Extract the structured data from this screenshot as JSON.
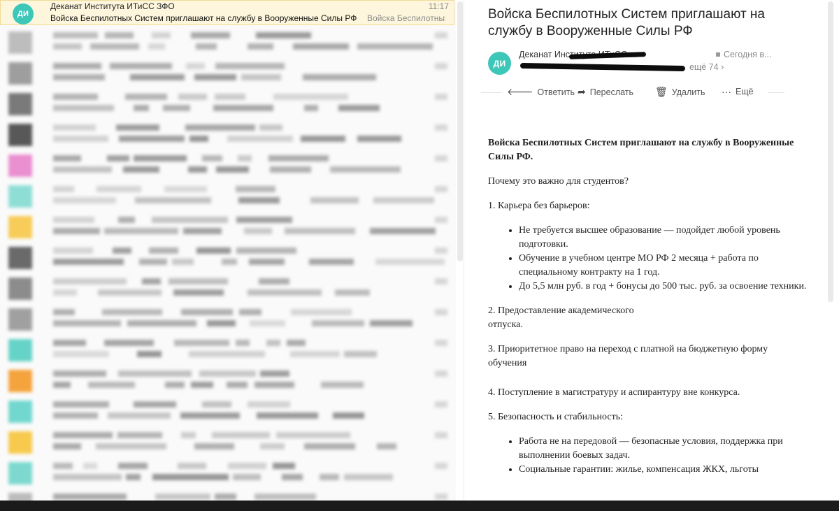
{
  "message_list": {
    "selected": {
      "avatar_initials": "ДИ",
      "sender": "Деканат Института ИТиСС ЗФО",
      "subject": "Войска Беспилотных Систем приглашают на службу в Вооруженные Силы РФ",
      "preview": "Войска Беспилотных Систем приглашают на службу в Вооруженные Силы РФ",
      "time": "11:17"
    }
  },
  "message": {
    "title": "Войска Беспилотных Систем приглашают на службу в Вооруженные Силы РФ",
    "avatar_initials": "ДИ",
    "from_name": "Деканат Института ИТиСС ...",
    "date": "Сегодня в...",
    "more_recipients": "ещё 74",
    "toolbar": {
      "reply": "Ответить",
      "forward": "Переслать",
      "delete": "Удалить",
      "more": "Ещё"
    },
    "body": {
      "heading": "Войска Беспилотных Систем приглашают на службу в Вооруженные Силы РФ.",
      "question": "Почему это важно для студентов?",
      "section1": "1. Карьера без барьеров:",
      "section1_items": [
        "Не требуется высшее образование — подойдет любой уровень подготовки.",
        "Обучение в учебном центре МО РФ 2 месяца + работа по специальному контракту на 1 год.",
        "До 5,5 млн руб. в год + бонусы до 500 тыс. руб. за освоение техники."
      ],
      "section2_line1": "2. Предоставление академического",
      "section2_line2": "отпуска.",
      "section3_line1": "3. Приоритетное право на переход с платной на бюджетную форму",
      "section3_line2": "обучения",
      "section4": "4. Поступление в магистратуру и аспирантуру вне конкурса.",
      "section5": "5. Безопасность и стабильность:",
      "section5_items": [
        "Работа не на передовой — безопасные условия, поддержка при выполнении боевых задач.",
        "Социальные гарантии: жилье, компенсация ЖКХ, льготы"
      ]
    }
  },
  "colors": {
    "avatar": "#3dc7b8",
    "selected_row": "#fdf6dc",
    "redaction": "#0d0d0d"
  }
}
